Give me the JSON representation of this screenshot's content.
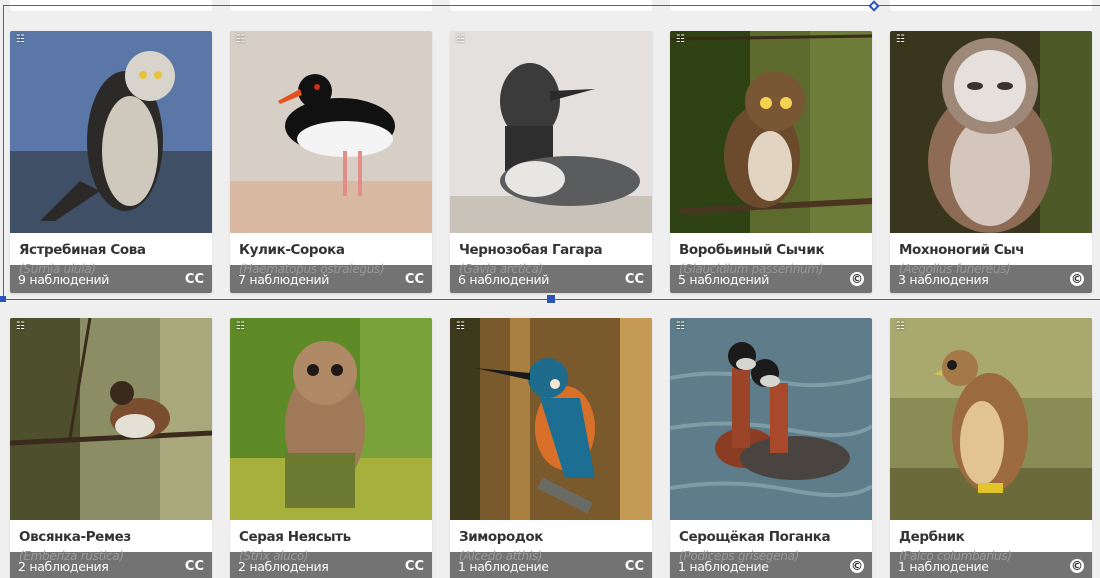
{
  "rows": [
    [
      {
        "count": "9 наблюдений",
        "license": "CC",
        "common": "Ястребиная Сова",
        "scientific": "(Surnia ulula)"
      },
      {
        "count": "7 наблюдений",
        "license": "CC",
        "common": "Кулик-Сорока",
        "scientific": "(Haematopus ostralegus)"
      },
      {
        "count": "6 наблюдений",
        "license": "CC",
        "common": "Чернозобая Гагара",
        "scientific": "(Gavia arctica)"
      },
      {
        "count": "5 наблюдений",
        "license": "©",
        "common": "Воробьиный Сычик",
        "scientific": "(Glaucidium passerinum)"
      },
      {
        "count": "3 наблюдения",
        "license": "©",
        "common": "Мохноногий Сыч",
        "scientific": "(Aegolius funereus)"
      }
    ],
    [
      {
        "count": "2 наблюдения",
        "license": "CC",
        "common": "Овсянка-Ремез",
        "scientific": "(Emberiza rustica)"
      },
      {
        "count": "2 наблюдения",
        "license": "CC",
        "common": "Серая Неясыть",
        "scientific": "(Strix aluco)"
      },
      {
        "count": "1 наблюдение",
        "license": "CC",
        "common": "Зимородок",
        "scientific": "(Alcedo atthis)"
      },
      {
        "count": "1 наблюдение",
        "license": "©",
        "common": "Серощёкая Поганка",
        "scientific": "(Podiceps grisegena)"
      },
      {
        "count": "1 наблюдение",
        "license": "©",
        "common": "Дербник",
        "scientific": "(Falco columbarius)"
      }
    ]
  ],
  "icons": {
    "photo_badge": "sliders-icon"
  }
}
